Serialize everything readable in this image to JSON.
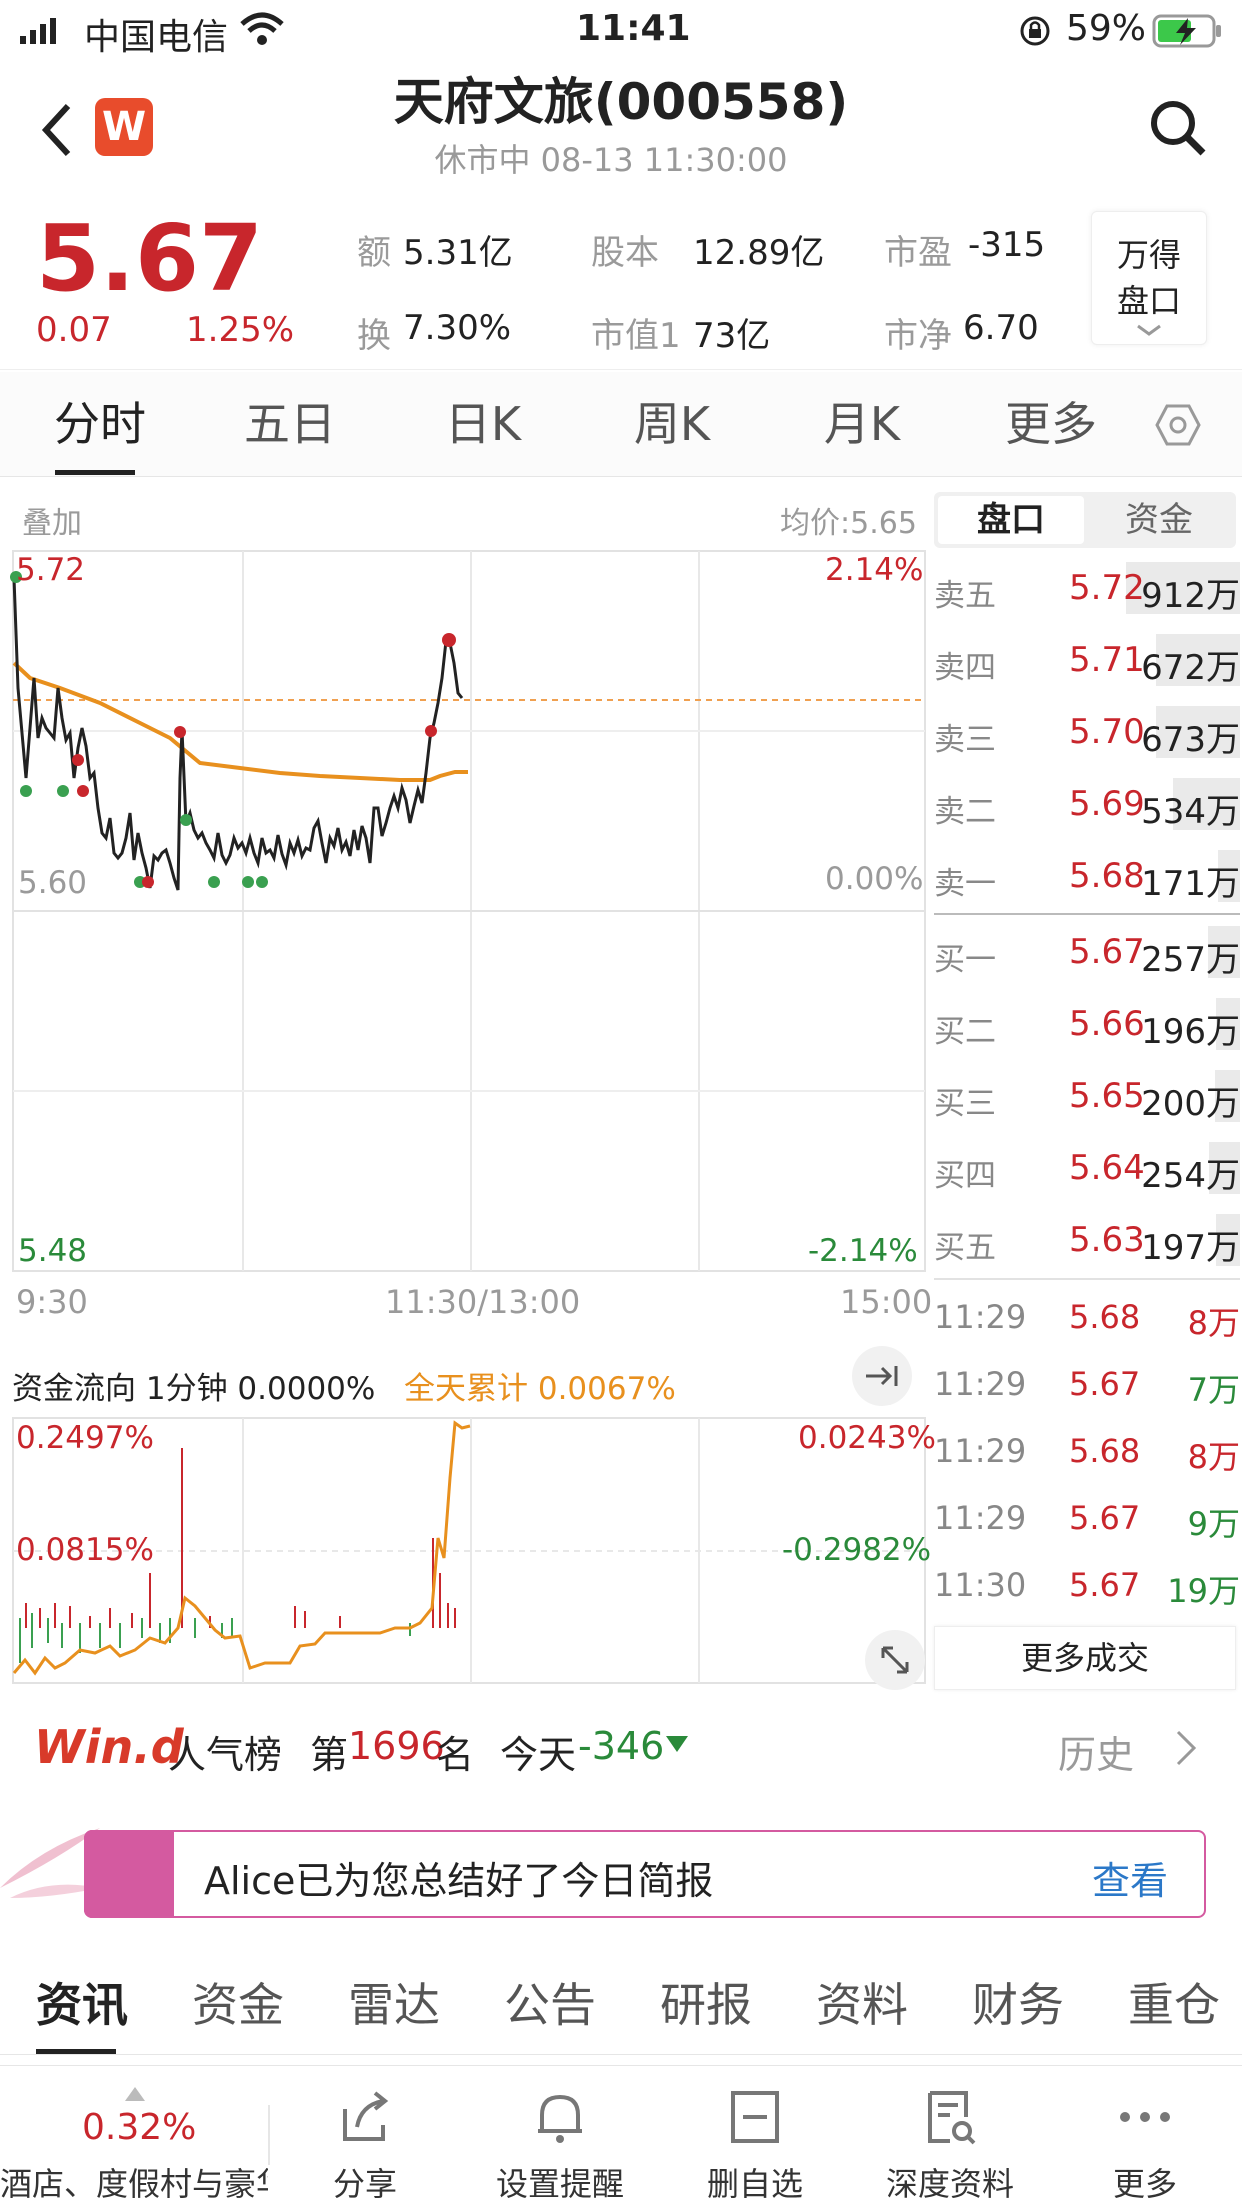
{
  "status_bar": {
    "carrier": "中国电信",
    "time": "11:41",
    "battery": "59%"
  },
  "nav": {
    "title": "天府文旅(000558)",
    "subtitle": "休市中 08-13 11:30:00",
    "logo": "W"
  },
  "quote": {
    "price": "5.67",
    "change": "0.07",
    "change_pct": "1.25%",
    "stats": [
      {
        "label": "额",
        "value": "5.31亿"
      },
      {
        "label": "股本",
        "value": "12.89亿"
      },
      {
        "label": "市盈",
        "value": "-315"
      },
      {
        "label": "换",
        "value": "7.30%"
      },
      {
        "label": "市值1",
        "value": "73亿"
      },
      {
        "label": "市净",
        "value": "6.70"
      }
    ],
    "wande_btn": [
      "万得",
      "盘口"
    ]
  },
  "period_tabs": [
    "分时",
    "五日",
    "日K",
    "周K",
    "月K",
    "更多"
  ],
  "chart": {
    "overlay_label": "叠加",
    "avg_label": "均价:5.65",
    "y_left": [
      "5.72",
      "5.60",
      "5.48"
    ],
    "y_right": [
      "2.14%",
      "0.00%",
      "-2.14%"
    ],
    "x_labels": [
      "9:30",
      "11:30/13:00",
      "15:00"
    ]
  },
  "fund_flow": {
    "title": "资金流向 1分钟 0.0000%",
    "cumulative": "全天累计 0.0067%",
    "left_top": "0.2497%",
    "left_mid": "0.0815%",
    "right_top": "0.0243%",
    "right_mid": "-0.2982%"
  },
  "book_tabs": [
    "盘口",
    "资金"
  ],
  "asks": [
    {
      "label": "卖五",
      "price": "5.72",
      "vol": "912万",
      "share": 0.95
    },
    {
      "label": "卖四",
      "price": "5.71",
      "vol": "672万",
      "share": 0.7
    },
    {
      "label": "卖三",
      "price": "5.70",
      "vol": "673万",
      "share": 0.7
    },
    {
      "label": "卖二",
      "price": "5.69",
      "vol": "534万",
      "share": 0.56
    },
    {
      "label": "卖一",
      "price": "5.68",
      "vol": "171万",
      "share": 0.18
    }
  ],
  "bids": [
    {
      "label": "买一",
      "price": "5.67",
      "vol": "257万",
      "share": 0.27
    },
    {
      "label": "买二",
      "price": "5.66",
      "vol": "196万",
      "share": 0.2
    },
    {
      "label": "买三",
      "price": "5.65",
      "vol": "200万",
      "share": 0.21
    },
    {
      "label": "买四",
      "price": "5.64",
      "vol": "254万",
      "share": 0.26
    },
    {
      "label": "买五",
      "price": "5.63",
      "vol": "197万",
      "share": 0.2
    }
  ],
  "trades": [
    {
      "time": "11:29",
      "price": "5.68",
      "vol": "8万",
      "side": "buy"
    },
    {
      "time": "11:29",
      "price": "5.67",
      "vol": "7万",
      "side": "sell"
    },
    {
      "time": "11:29",
      "price": "5.68",
      "vol": "8万",
      "side": "buy"
    },
    {
      "time": "11:29",
      "price": "5.67",
      "vol": "9万",
      "side": "sell"
    },
    {
      "time": "11:30",
      "price": "5.67",
      "vol": "19万",
      "side": "sell"
    }
  ],
  "more_trades": "更多成交",
  "popularity": {
    "logo": "Win.d",
    "label": "人气榜",
    "rank_prefix": "第",
    "rank": "1696",
    "rank_suffix": "名",
    "today_label": "今天",
    "today_change": "-346",
    "history": "历史"
  },
  "alice": {
    "text": "Alice已为您总结好了今日简报",
    "action": "查看"
  },
  "news_tabs": [
    "资讯",
    "资金",
    "雷达",
    "公告",
    "研报",
    "资料",
    "财务",
    "重仓"
  ],
  "bottom_bar": {
    "sector_pct": "0.32%",
    "sector_name": "酒店、度假村与豪华",
    "buttons": [
      "分享",
      "设置提醒",
      "删自选",
      "深度资料",
      "更多"
    ]
  }
}
